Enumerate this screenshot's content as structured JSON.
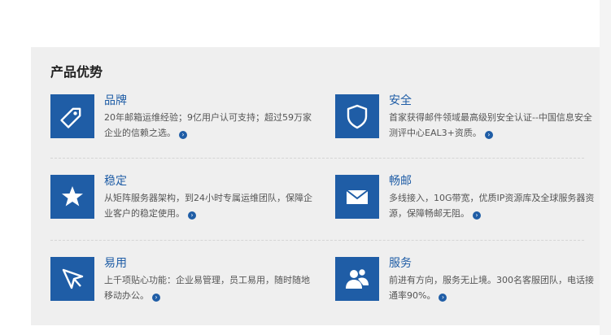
{
  "section_title": "产品优势",
  "colors": {
    "accent": "#1f5da6",
    "panel_bg": "#efefef"
  },
  "features": [
    {
      "title": "品牌",
      "icon": "tag-icon",
      "desc": "20年邮箱运维经验；9亿用户认可支持；超过59万家企业的信赖之选。"
    },
    {
      "title": "安全",
      "icon": "shield-icon",
      "desc": "首家获得邮件领域最高级别安全认证--中国信息安全测评中心EAL3+资质。"
    },
    {
      "title": "稳定",
      "icon": "star-icon",
      "desc": "从矩阵服务器架构，到24小时专属运维团队，保障企业客户的稳定使用。"
    },
    {
      "title": "畅邮",
      "icon": "envelope-icon",
      "desc": "多线接入，10G带宽，优质IP资源库及全球服务器资源，保障畅邮无阻。"
    },
    {
      "title": "易用",
      "icon": "cursor-icon",
      "desc": "上千项贴心功能：企业易管理，员工易用，随时随地移动办公。"
    },
    {
      "title": "服务",
      "icon": "team-icon",
      "desc": "前进有方向，服务无止境。300名客服团队，电话接通率90%。"
    }
  ]
}
